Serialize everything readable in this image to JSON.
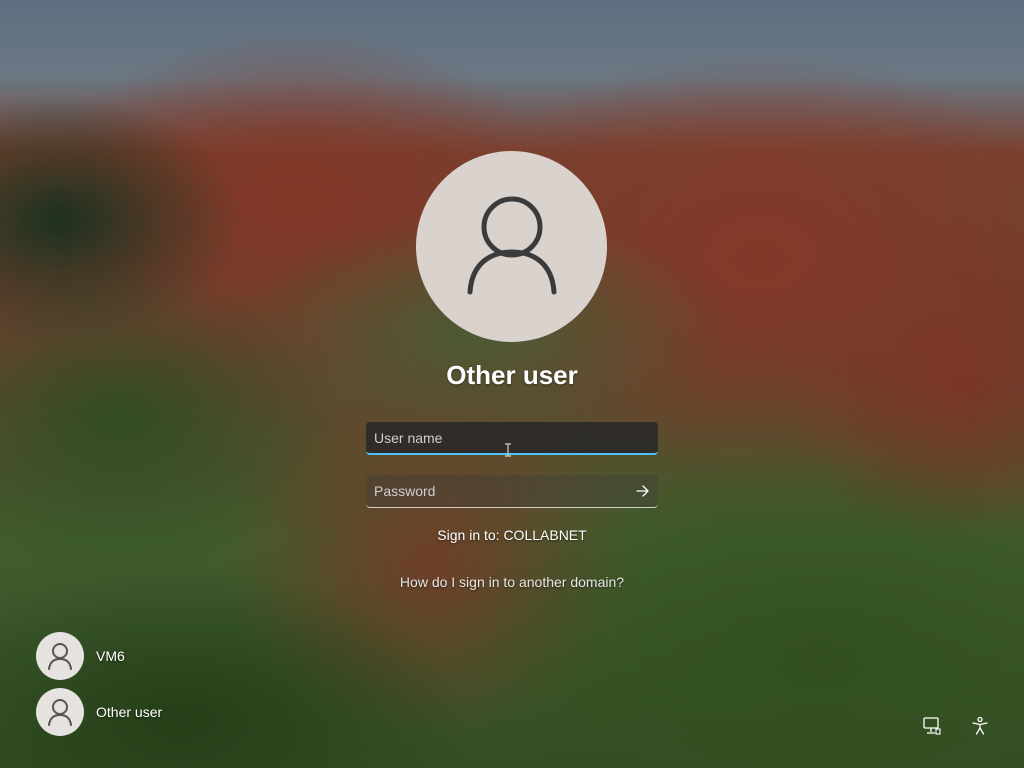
{
  "login": {
    "title": "Other user",
    "username_placeholder": "User name",
    "password_placeholder": "Password",
    "sign_in_to": "Sign in to: COLLABNET",
    "other_domain_link": "How do I sign in to another domain?"
  },
  "users": [
    {
      "label": "VM6"
    },
    {
      "label": "Other user"
    }
  ],
  "icons": {
    "avatar": "user-icon",
    "submit": "arrow-right-icon",
    "network": "network-icon",
    "accessibility": "accessibility-icon"
  },
  "colors": {
    "focus_accent": "#4cc2ff",
    "avatar_bg": "#d9d2cd",
    "text": "#ffffff"
  }
}
